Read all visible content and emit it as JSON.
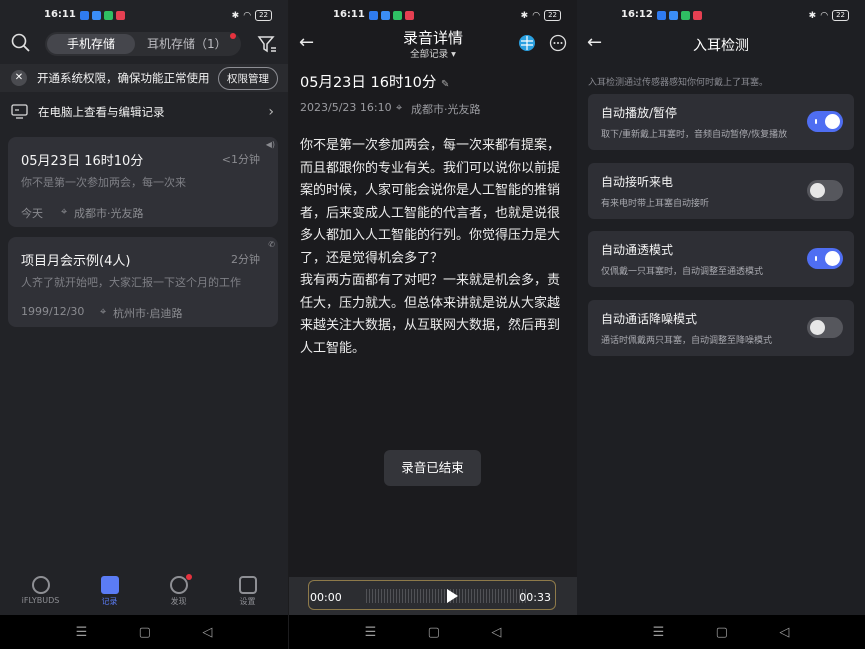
{
  "colors": {
    "accent": "#4f6ef2",
    "notification_red": "#e6323e"
  },
  "screen1": {
    "status": {
      "time": "16:11",
      "battery": "22"
    },
    "storage_tabs": {
      "phone": "手机存储",
      "earbuds": "耳机存储（1）"
    },
    "banner": {
      "text": "开通系统权限，确保功能正常使用",
      "button": "权限管理"
    },
    "pc_row": "在电脑上查看与编辑记录",
    "records": [
      {
        "title": "05月23日 16时10分",
        "duration": "<1分钟",
        "preview": "你不是第一次参加两会，每一次来",
        "date": "今天",
        "location": "成都市·光友路"
      },
      {
        "title": "项目月会示例(4人)",
        "duration": "2分钟",
        "preview": "人齐了就开始吧，大家汇报一下这个月的工作",
        "date": "1999/12/30",
        "location": "杭州市·启迪路"
      }
    ],
    "tabs": [
      {
        "label": "iFLYBUDS",
        "icon": "iflybuds-icon"
      },
      {
        "label": "记录",
        "icon": "record-icon"
      },
      {
        "label": "发现",
        "icon": "compass-icon"
      },
      {
        "label": "设置",
        "icon": "settings-icon"
      }
    ]
  },
  "screen2": {
    "status": {
      "time": "16:11",
      "battery": "22"
    },
    "title": "录音详情",
    "subtitle": "全部记录",
    "record_title": "05月23日 16时10分",
    "datetime": "2023/5/23 16:10",
    "location": "成都市·光友路",
    "paragraphs": [
      "你不是第一次参加两会，每一次来都有提案，而且都跟你的专业有关。我们可以说你以前提案的时候，人家可能会说你是人工智能的推销者，后来变成人工智能的代言者，也就是说很多人都加入人工智能的行列。你觉得压力是大了，还是觉得机会多了？",
      "我有两方面都有了对吧？一来就是机会多，责任大，压力就大。但总体来讲就是说从大家越来越关注大数据，从互联网大数据，然后再到人工智能。"
    ],
    "toast": "录音已结束",
    "player": {
      "current": "00:00",
      "total": "00:33"
    }
  },
  "screen3": {
    "status": {
      "time": "16:12",
      "battery": "22"
    },
    "title": "入耳检测",
    "hint": "入耳检测通过传感器感知你何时戴上了耳塞。",
    "settings": [
      {
        "label": "自动播放/暂停",
        "desc": "取下/重新戴上耳塞时，音频自动暂停/恢复播放",
        "on": true
      },
      {
        "label": "自动接听来电",
        "desc": "有来电时带上耳塞自动接听",
        "on": false
      },
      {
        "label": "自动通透模式",
        "desc": "仅佩戴一只耳塞时，自动调整至通透模式",
        "on": true
      },
      {
        "label": "自动通话降噪模式",
        "desc": "通话时佩戴两只耳塞，自动调整至降噪模式",
        "on": false
      }
    ]
  }
}
